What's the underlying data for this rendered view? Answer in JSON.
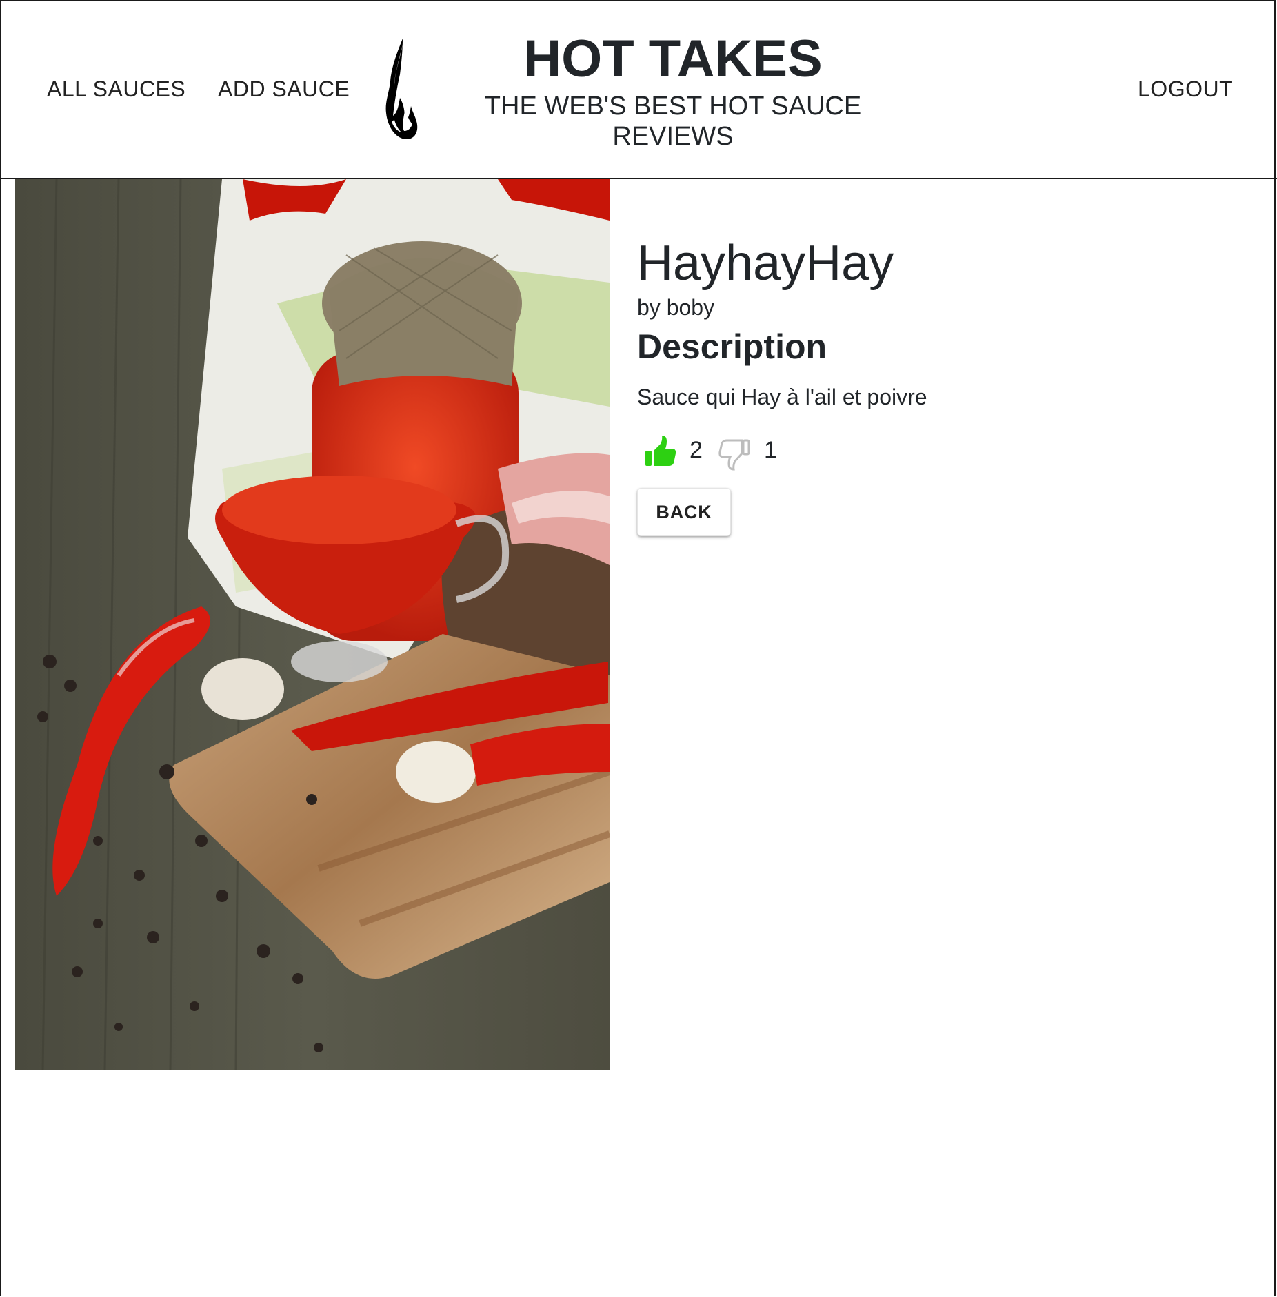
{
  "nav": {
    "all_sauces": "ALL SAUCES",
    "add_sauce": "ADD SAUCE",
    "logout": "LOGOUT"
  },
  "brand": {
    "title": "HOT TAKES",
    "subtitle_line1": "THE WEB'S BEST HOT SAUCE",
    "subtitle_line2": "REVIEWS",
    "logo_icon": "flame-icon"
  },
  "sauce": {
    "name": "HayhayHay",
    "by": "by boby",
    "description_heading": "Description",
    "description": "Sauce qui Hay à l'ail et poivre",
    "likes": "2",
    "dislikes": "1",
    "like_icon": "thumbs-up-icon",
    "dislike_icon": "thumbs-down-icon",
    "image_alt": "sauce-photo"
  },
  "actions": {
    "back_label": "BACK"
  },
  "colors": {
    "like_active": "#2dd012",
    "dislike_inactive": "#bdbdbd",
    "text": "#212529"
  }
}
